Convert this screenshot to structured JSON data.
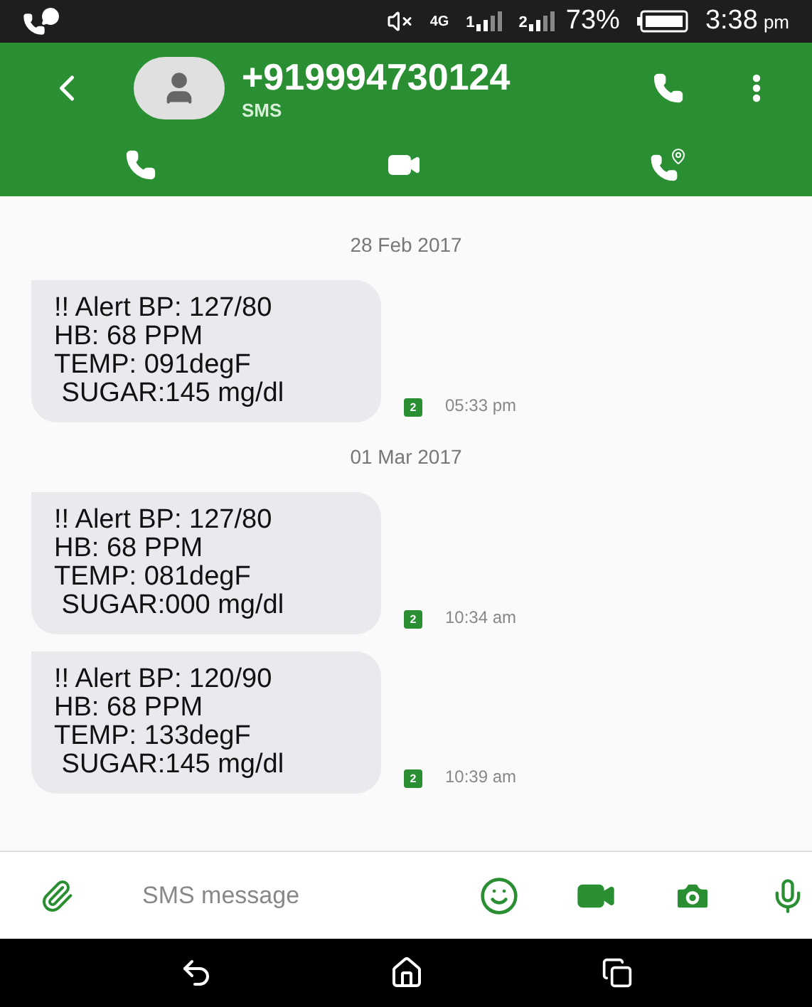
{
  "status_bar": {
    "network": "4G",
    "sim1": "1",
    "sim2": "2",
    "battery": "73%",
    "time": "3:38",
    "ampm": "pm"
  },
  "header": {
    "contact": "+919994730124",
    "subtitle": "SMS"
  },
  "thread": [
    {
      "kind": "date",
      "text": "28 Feb 2017"
    },
    {
      "kind": "message",
      "lines": [
        "!! Alert BP: 127/80",
        "HB: 68 PPM",
        "TEMP: 091degF",
        " SUGAR:145 mg/dl"
      ],
      "sim": "2",
      "time": "05:33 pm"
    },
    {
      "kind": "date",
      "text": "01 Mar 2017"
    },
    {
      "kind": "message",
      "lines": [
        "!! Alert BP: 127/80",
        "HB: 68 PPM",
        "TEMP: 081degF",
        " SUGAR:000 mg/dl"
      ],
      "sim": "2",
      "time": "10:34 am"
    },
    {
      "kind": "message",
      "lines": [
        "!! Alert BP: 120/90",
        "HB: 68 PPM",
        "TEMP: 133degF",
        " SUGAR:145 mg/dl"
      ],
      "sim": "2",
      "time": "10:39 am"
    }
  ],
  "composer": {
    "placeholder": "SMS message"
  }
}
